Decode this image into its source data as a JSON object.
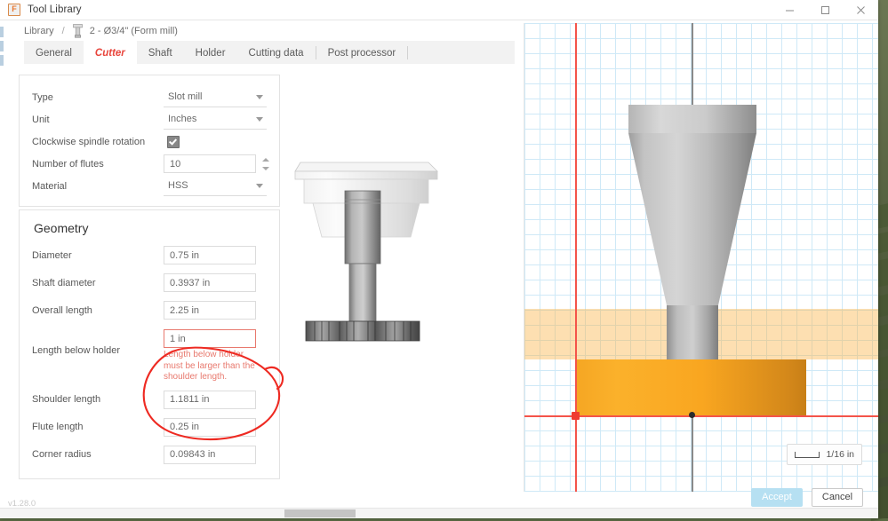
{
  "window": {
    "title": "Tool Library",
    "app_icon": "fusion-icon",
    "controls": {
      "minimize": "minimize-icon",
      "maximize": "maximize-icon",
      "close": "close-icon"
    }
  },
  "breadcrumb": {
    "root": "Library",
    "separator": "/",
    "tool_icon": "tool-icon",
    "current": "2 - Ø3/4\" (Form mill)"
  },
  "tabs": [
    {
      "label": "General",
      "active": false
    },
    {
      "label": "Cutter",
      "active": true
    },
    {
      "label": "Shaft",
      "active": false
    },
    {
      "label": "Holder",
      "active": false
    },
    {
      "label": "Cutting data",
      "active": false
    },
    {
      "label": "Post processor",
      "active": false
    }
  ],
  "general_card": {
    "rows": [
      {
        "label": "Type",
        "value": "Slot mill",
        "control": "select"
      },
      {
        "label": "Unit",
        "value": "Inches",
        "control": "select"
      },
      {
        "label": "Clockwise spindle rotation",
        "value": "",
        "control": "checkbox",
        "checked": true
      },
      {
        "label": "Number of flutes",
        "value": "10",
        "control": "stepper"
      },
      {
        "label": "Material",
        "value": "HSS",
        "control": "select"
      }
    ]
  },
  "geometry_card": {
    "title": "Geometry",
    "rows": [
      {
        "label": "Diameter",
        "value": "0.75 in",
        "error": ""
      },
      {
        "label": "Shaft diameter",
        "value": "0.3937 in",
        "error": ""
      },
      {
        "label": "Overall length",
        "value": "2.25 in",
        "error": ""
      },
      {
        "label": "Length below holder",
        "value": "1 in",
        "error": "Length below holder must be larger than the shoulder length."
      },
      {
        "label": "Shoulder length",
        "value": "1.1811 in",
        "error": ""
      },
      {
        "label": "Flute length",
        "value": "0.25 in",
        "error": ""
      },
      {
        "label": "Corner radius",
        "value": "0.09843 in",
        "error": ""
      }
    ]
  },
  "viewport": {
    "scale_label": "1/16 in",
    "scale_icon": "scale-bar-icon",
    "grid": "on",
    "axis_color": "#f4544a",
    "stock_color": "#f9a620",
    "stock_band_color": "#fab246"
  },
  "buttons": {
    "accept": "Accept",
    "cancel": "Cancel",
    "accept_enabled": false
  },
  "footer": {
    "version": "v1.28.0"
  },
  "colors": {
    "accent_red": "#e8453c",
    "error_red": "#e8796e",
    "accept_disabled": "#b6e0f2",
    "grid_blue": "#cfe9f7"
  }
}
